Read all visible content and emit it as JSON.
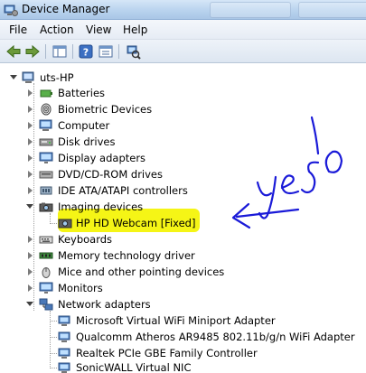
{
  "window": {
    "title": "Device Manager"
  },
  "menu": {
    "items": [
      "File",
      "Action",
      "View",
      "Help"
    ]
  },
  "toolbar": {
    "buttons": [
      "back-icon",
      "forward-icon",
      "properties-pane-icon",
      "show-hide-tree-icon",
      "help-icon",
      "console-tree-icon",
      "scan-hardware-icon"
    ]
  },
  "tree": {
    "root": "uts-HP",
    "categories": [
      {
        "label": "Batteries",
        "icon": "battery-icon",
        "expanded": false
      },
      {
        "label": "Biometric Devices",
        "icon": "fingerprint-icon",
        "expanded": false
      },
      {
        "label": "Computer",
        "icon": "computer-icon",
        "expanded": false
      },
      {
        "label": "Disk drives",
        "icon": "disk-icon",
        "expanded": false
      },
      {
        "label": "Display adapters",
        "icon": "monitor-icon",
        "expanded": false
      },
      {
        "label": "DVD/CD-ROM drives",
        "icon": "dvd-icon",
        "expanded": false
      },
      {
        "label": "IDE ATA/ATAPI controllers",
        "icon": "ide-icon",
        "expanded": false
      },
      {
        "label": "Imaging devices",
        "icon": "camera-icon",
        "expanded": true
      },
      {
        "label": "HP HD Webcam [Fixed]",
        "icon": "webcam-icon",
        "child": true,
        "highlighted": true
      },
      {
        "label": "Keyboards",
        "icon": "keyboard-icon",
        "expanded": false
      },
      {
        "label": "Memory technology driver",
        "icon": "memory-icon",
        "expanded": false
      },
      {
        "label": "Mice and other pointing devices",
        "icon": "mouse-icon",
        "expanded": false
      },
      {
        "label": "Monitors",
        "icon": "monitor-icon",
        "expanded": false
      },
      {
        "label": "Network adapters",
        "icon": "network-icon",
        "expanded": true
      },
      {
        "label": "Microsoft Virtual WiFi Miniport Adapter",
        "icon": "network-adapter-icon",
        "child": true
      },
      {
        "label": "Qualcomm Atheros AR9485 802.11b/g/n WiFi Adapter",
        "icon": "network-adapter-icon",
        "child": true
      },
      {
        "label": "Realtek PCIe GBE Family Controller",
        "icon": "network-adapter-icon",
        "child": true
      },
      {
        "label": "SonicWALL Virtual NIC",
        "icon": "network-adapter-icon",
        "child": true
      }
    ]
  },
  "annotation": {
    "text": "yeso",
    "color": "#1a1ad8",
    "highlight_color": "#f5f516"
  }
}
